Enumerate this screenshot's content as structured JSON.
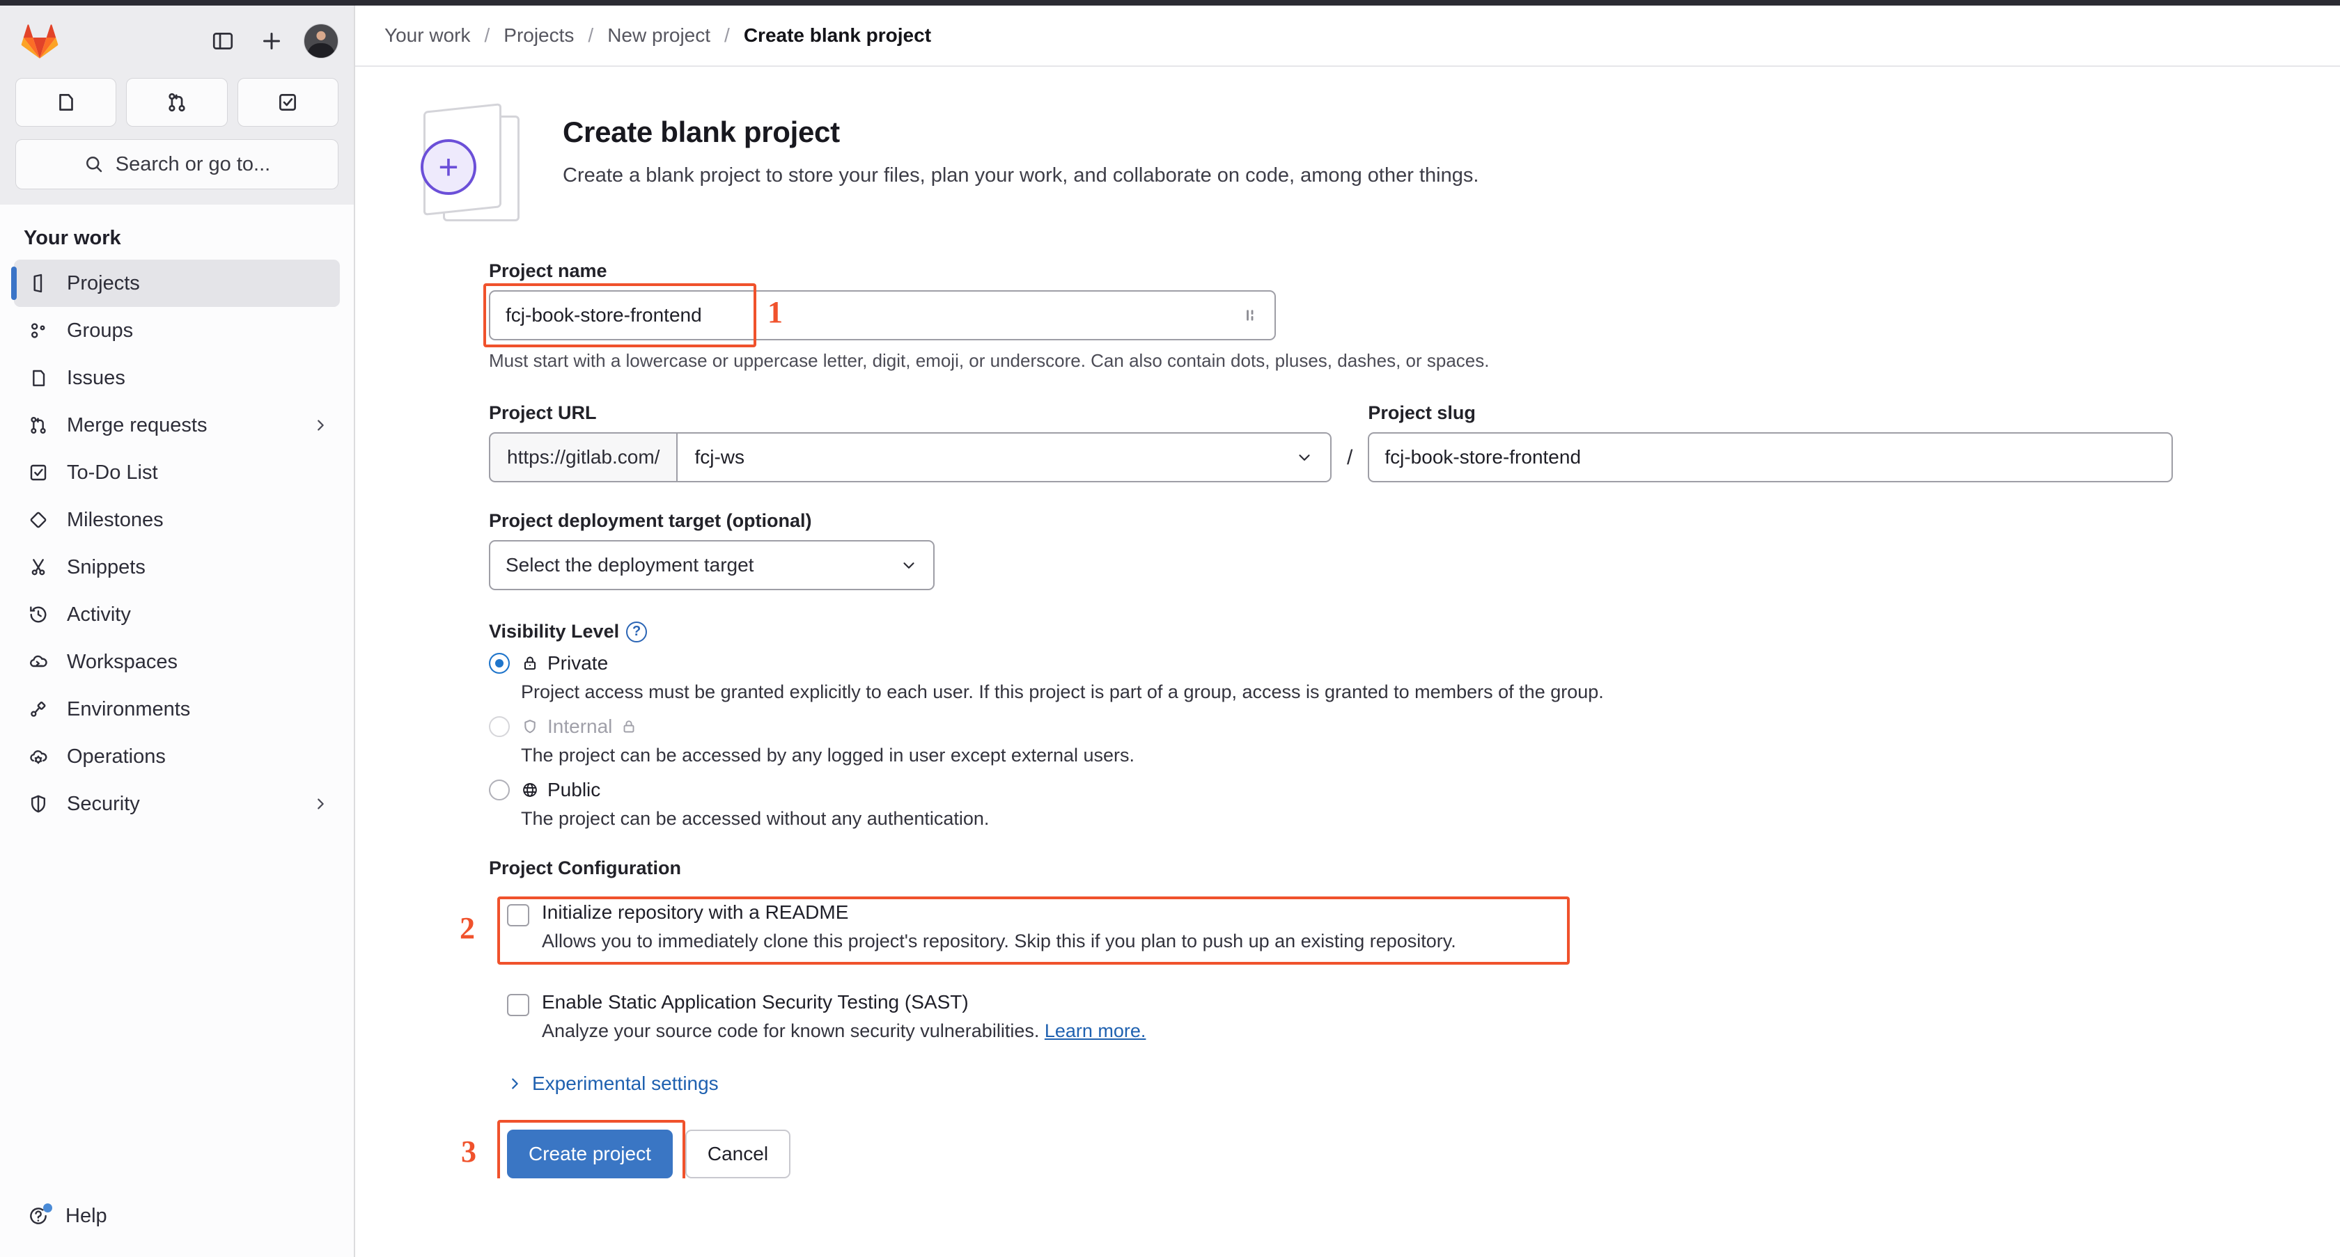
{
  "sidebar": {
    "brand": "gitlab-logo",
    "top_actions": [
      {
        "name": "toggle-sidebar",
        "icon": "panel-icon"
      },
      {
        "name": "create-new",
        "icon": "plus-icon"
      },
      {
        "name": "user-avatar",
        "icon": "avatar-icon"
      }
    ],
    "quick_actions": [
      {
        "name": "issues",
        "icon": "issue-icon"
      },
      {
        "name": "merge-requests",
        "icon": "merge-request-icon"
      },
      {
        "name": "todos",
        "icon": "todo-icon"
      }
    ],
    "search_placeholder": "Search or go to...",
    "section_title": "Your work",
    "items": [
      {
        "label": "Projects",
        "icon": "project-icon",
        "active": true,
        "chevron": false
      },
      {
        "label": "Groups",
        "icon": "group-icon",
        "active": false,
        "chevron": false
      },
      {
        "label": "Issues",
        "icon": "issue-icon",
        "active": false,
        "chevron": false
      },
      {
        "label": "Merge requests",
        "icon": "merge-request-icon",
        "active": false,
        "chevron": true
      },
      {
        "label": "To-Do List",
        "icon": "todo-icon",
        "active": false,
        "chevron": false
      },
      {
        "label": "Milestones",
        "icon": "milestone-icon",
        "active": false,
        "chevron": false
      },
      {
        "label": "Snippets",
        "icon": "snippet-icon",
        "active": false,
        "chevron": false
      },
      {
        "label": "Activity",
        "icon": "activity-icon",
        "active": false,
        "chevron": false
      },
      {
        "label": "Workspaces",
        "icon": "workspace-icon",
        "active": false,
        "chevron": false
      },
      {
        "label": "Environments",
        "icon": "environment-icon",
        "active": false,
        "chevron": false
      },
      {
        "label": "Operations",
        "icon": "operations-icon",
        "active": false,
        "chevron": false
      },
      {
        "label": "Security",
        "icon": "security-icon",
        "active": false,
        "chevron": true
      }
    ],
    "help_label": "Help",
    "help_has_notification": true
  },
  "breadcrumb": {
    "items": [
      "Your work",
      "Projects",
      "New project",
      "Create blank project"
    ],
    "separator": "/"
  },
  "page": {
    "title": "Create blank project",
    "subtitle": "Create a blank project to store your files, plan your work, and collaborate on code, among other things."
  },
  "form": {
    "project_name": {
      "label": "Project name",
      "value": "fcj-book-store-frontend",
      "hint": "Must start with a lowercase or uppercase letter, digit, emoji, or underscore. Can also contain dots, pluses, dashes, or spaces.",
      "resize_glyph": "⦙⦙"
    },
    "project_url": {
      "label": "Project URL",
      "prefix": "https://gitlab.com/",
      "namespace": "fcj-ws",
      "chevron": "⌄"
    },
    "path_separator": "/",
    "project_slug": {
      "label": "Project slug",
      "value": "fcj-book-store-frontend"
    },
    "deployment_target": {
      "label": "Project deployment target (optional)",
      "value": "Select the deployment target",
      "chevron": "⌄"
    },
    "visibility": {
      "label": "Visibility Level",
      "help_glyph": "?",
      "options": [
        {
          "name": "Private",
          "icon": "lock-icon",
          "selected": true,
          "disabled": false,
          "description": "Project access must be granted explicitly to each user. If this project is part of a group, access is granted to members of the group."
        },
        {
          "name": "Internal",
          "icon": "shield-icon",
          "trailing_icon": "lock-icon",
          "selected": false,
          "disabled": true,
          "description": "The project can be accessed by any logged in user except external users."
        },
        {
          "name": "Public",
          "icon": "globe-icon",
          "selected": false,
          "disabled": false,
          "description": "The project can be accessed without any authentication."
        }
      ]
    },
    "configuration": {
      "title": "Project Configuration",
      "readme": {
        "label": "Initialize repository with a README",
        "description": "Allows you to immediately clone this project's repository. Skip this if you plan to push up an existing repository.",
        "checked": false
      },
      "sast": {
        "label": "Enable Static Application Security Testing (SAST)",
        "description": "Analyze your source code for known security vulnerabilities.",
        "link_text": "Learn more.",
        "checked": false
      }
    },
    "experimental_settings": {
      "label": "Experimental settings",
      "chevron": "›"
    },
    "actions": {
      "submit": "Create project",
      "cancel": "Cancel"
    }
  },
  "annotations": {
    "color": "#f0522c",
    "markers": [
      {
        "number": "1",
        "target": "project-name-input"
      },
      {
        "number": "2",
        "target": "readme-checkbox-row"
      },
      {
        "number": "3",
        "target": "create-project-button"
      }
    ]
  }
}
